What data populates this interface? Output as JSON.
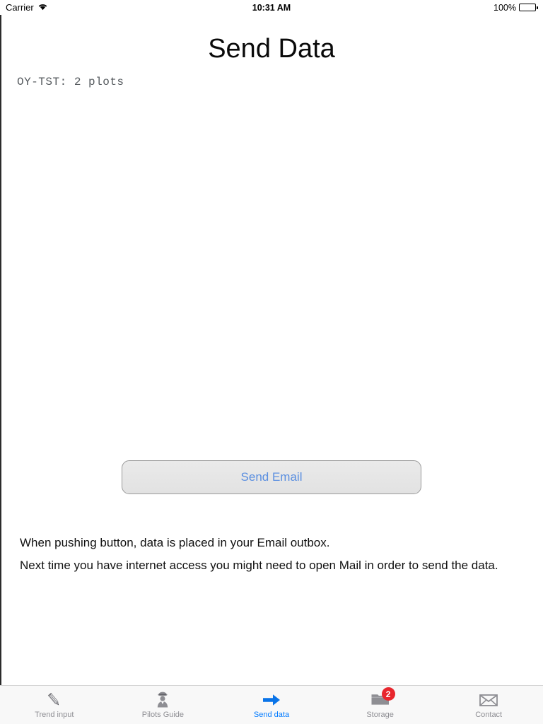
{
  "status_bar": {
    "carrier": "Carrier",
    "wifi_icon": "wifi-icon",
    "time": "10:31 AM",
    "battery_percent": "100%",
    "battery_icon": "battery-full-icon"
  },
  "header": {
    "title": "Send Data"
  },
  "main": {
    "plot_count_text": "OY-TST: 2 plots",
    "send_button_label": "Send Email",
    "info_lines": [
      "When pushing button, data is placed in your Email outbox.",
      "Next time you have internet access you might need to open Mail in order to send the data."
    ]
  },
  "colors": {
    "accent_blue": "#007aff",
    "button_text_blue": "#5b8fe0",
    "badge_red": "#e8262d",
    "tab_inactive_gray": "#8e8e93",
    "mono_text_gray": "#555a5e"
  },
  "tab_bar": {
    "items": [
      {
        "label": "Trend input",
        "icon": "pencil-icon",
        "active": false,
        "badge": null
      },
      {
        "label": "Pilots Guide",
        "icon": "pilot-icon",
        "active": false,
        "badge": null
      },
      {
        "label": "Send data",
        "icon": "arrow-right-icon",
        "active": true,
        "badge": null
      },
      {
        "label": "Storage",
        "icon": "folder-icon",
        "active": false,
        "badge": "2"
      },
      {
        "label": "Contact",
        "icon": "envelope-icon",
        "active": false,
        "badge": null
      }
    ]
  }
}
